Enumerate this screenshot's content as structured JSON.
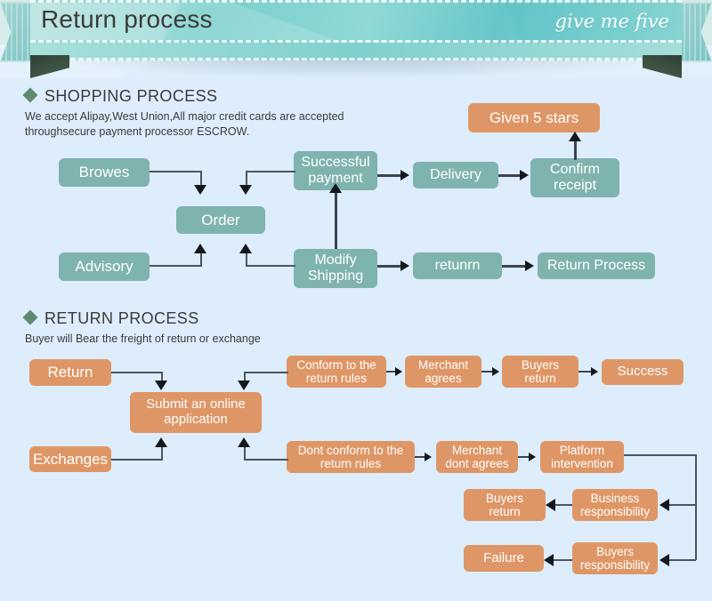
{
  "banner": {
    "title": "Return process",
    "brand": "give me five"
  },
  "shopping": {
    "heading": "SHOPPING PROCESS",
    "description": "We accept Alipay,West Union,All major credit cards are accepted throughsecure payment processor ESCROW.",
    "description_line1": "We accept Alipay,West Union,All major credit cards are accepted",
    "description_line2": "throughsecure payment processor ESCROW.",
    "nodes": {
      "browes": "Browes",
      "advisory": "Advisory",
      "order": "Order",
      "successful_payment_l1": "Successful",
      "successful_payment_l2": "payment",
      "modify_shipping_l1": "Modify",
      "modify_shipping_l2": "Shipping",
      "delivery": "Delivery",
      "confirm_receipt_l1": "Confirm",
      "confirm_receipt_l2": "receipt",
      "given_5_stars": "Given 5 stars",
      "returnn": "retunrn",
      "return_process": "Return Process"
    }
  },
  "returns": {
    "heading": "RETURN PROCESS",
    "description": "Buyer will Bear the freight of return or exchange",
    "nodes": {
      "return": "Return",
      "exchanges": "Exchanges",
      "submit_l1": "Submit an online",
      "submit_l2": "application",
      "conform_l1": "Conform to the",
      "conform_l2": "return rules",
      "merchant_agrees_l1": "Merchant",
      "merchant_agrees_l2": "agrees",
      "buyers_return_l1": "Buyers",
      "buyers_return_l2": "return",
      "success": "Success",
      "dont_conform_l1": "Dont conform to the",
      "dont_conform_l2": "return rules",
      "merchant_dont_l1": "Merchant",
      "merchant_dont_l2": "dont agrees",
      "platform_l1": "Platform",
      "platform_l2": "intervention",
      "business_resp_l1": "Business",
      "business_resp_l2": "responsibility",
      "buyers_return2_l1": "Buyers",
      "buyers_return2_l2": "return",
      "buyers_resp_l1": "Buyers",
      "buyers_resp_l2": "responsibility",
      "failure": "Failure"
    }
  },
  "colors": {
    "teal": "#7fb3ae",
    "orange": "#df9666",
    "background": "#ddedfb",
    "banner": "#7fcfcc",
    "diamond": "#5d8a70",
    "connector": "#3c444c"
  }
}
